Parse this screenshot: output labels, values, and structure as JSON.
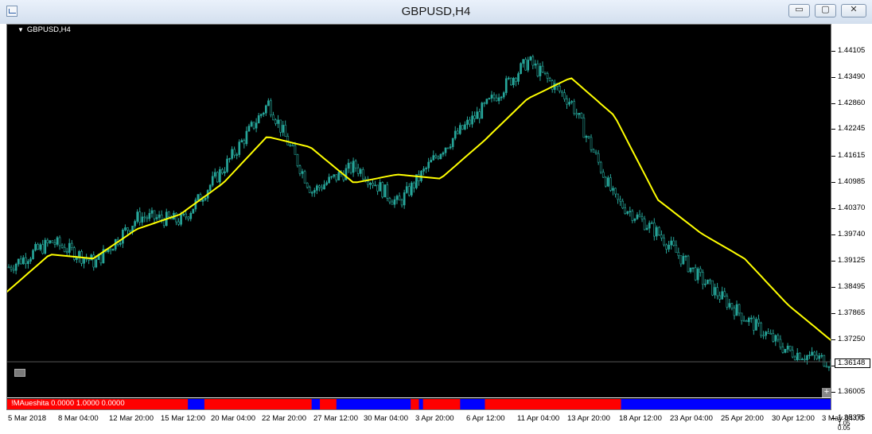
{
  "window": {
    "title": "GBPUSD,H4",
    "min_glyph": "▭",
    "max_glyph": "▢",
    "close_glyph": "✕"
  },
  "chart": {
    "symbol_label": "GBPUSD,H4",
    "indicator_label": "!MAueshita 0.0000 1.0000 0.0000",
    "current_price": "1.36148",
    "price_labels": [
      "1.44105",
      "1.43490",
      "1.42860",
      "1.42245",
      "1.41615",
      "1.40985",
      "1.40370",
      "1.39740",
      "1.39125",
      "1.38495",
      "1.37865",
      "1.37250",
      "1.36620",
      "1.36005",
      "1.35375"
    ],
    "sub_labels": [
      "1.05",
      "0.05"
    ],
    "time_labels": [
      "5 Mar 2018",
      "8 Mar 04:00",
      "12 Mar 20:00",
      "15 Mar 12:00",
      "20 Mar 04:00",
      "22 Mar 20:00",
      "27 Mar 12:00",
      "30 Mar 04:00",
      "3 Apr 20:00",
      "6 Apr 12:00",
      "11 Apr 04:00",
      "13 Apr 20:00",
      "18 Apr 12:00",
      "23 Apr 04:00",
      "25 Apr 20:00",
      "30 Apr 12:00",
      "3 May 04:00"
    ],
    "colors": {
      "background": "#000000",
      "candle": "#26a69a",
      "ma": "#ffff00",
      "bull_bar": "#ff0000",
      "bear_bar": "#0000ff",
      "grid": "#ffffff"
    }
  },
  "chart_data": {
    "type": "line",
    "title": "GBPUSD,H4",
    "ylim": [
      1.35375,
      1.44105
    ],
    "x": [
      "5 Mar 2018",
      "8 Mar 04:00",
      "12 Mar 20:00",
      "15 Mar 12:00",
      "20 Mar 04:00",
      "22 Mar 20:00",
      "27 Mar 12:00",
      "30 Mar 04:00",
      "3 Apr 20:00",
      "6 Apr 12:00",
      "11 Apr 04:00",
      "13 Apr 20:00",
      "18 Apr 12:00",
      "23 Apr 04:00",
      "25 Apr 20:00",
      "30 Apr 12:00",
      "3 May 04:00"
    ],
    "series": [
      {
        "values": [
          1.384,
          1.39,
          1.385,
          1.396,
          1.395,
          1.408,
          1.423,
          1.402,
          1.408,
          1.399,
          1.412,
          1.422,
          1.433,
          1.423,
          1.4,
          1.392,
          1.381,
          1.372,
          1.364,
          1.3615
        ]
      },
      {
        "values": [
          1.378,
          1.387,
          1.386,
          1.393,
          1.3965,
          1.404,
          1.415,
          1.4125,
          1.404,
          1.406,
          1.405,
          1.414,
          1.424,
          1.429,
          1.42,
          1.4,
          1.392,
          1.386,
          1.375,
          1.3665
        ]
      }
    ]
  }
}
